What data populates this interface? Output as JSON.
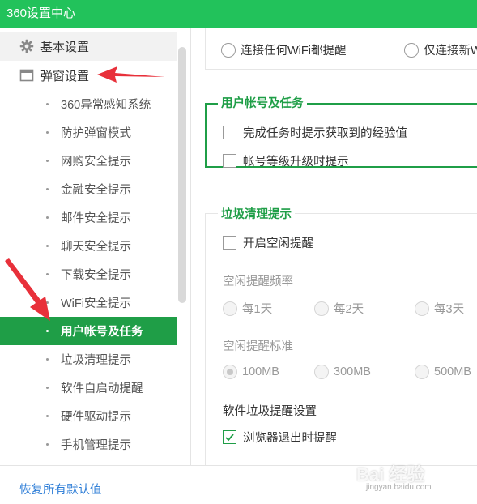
{
  "window": {
    "title": "360设置中心"
  },
  "sidebar": {
    "basic_label": "基本设置",
    "popup_label": "弹窗设置",
    "items": [
      {
        "label": "360异常感知系统"
      },
      {
        "label": "防护弹窗模式"
      },
      {
        "label": "网购安全提示"
      },
      {
        "label": "金融安全提示"
      },
      {
        "label": "邮件安全提示"
      },
      {
        "label": "聊天安全提示"
      },
      {
        "label": "下载安全提示"
      },
      {
        "label": "WiFi安全提示"
      },
      {
        "label": "用户帐号及任务"
      },
      {
        "label": "垃圾清理提示"
      },
      {
        "label": "软件自启动提醒"
      },
      {
        "label": "硬件驱动提示"
      },
      {
        "label": "手机管理提示"
      }
    ],
    "active_item": "用户帐号及任务"
  },
  "footer": {
    "restore_label": "恢复所有默认值"
  },
  "main": {
    "wifi": {
      "option_any": "连接任何WiFi都提醒",
      "option_new": "仅连接新Wi"
    },
    "account": {
      "title": "用户帐号及任务",
      "option_exp": "完成任务时提示获取到的经验值",
      "option_level": "帐号等级升级时提示"
    },
    "cleanup": {
      "title": "垃圾清理提示",
      "idle_toggle": "开启空闲提醒",
      "freq_label": "空闲提醒频率",
      "freq_options": [
        "每1天",
        "每2天",
        "每3天"
      ],
      "std_label": "空闲提醒标准",
      "std_options": [
        "100MB",
        "300MB",
        "500MB"
      ],
      "std_selected": "100MB",
      "software_label": "软件垃圾提醒设置",
      "browser_exit": "浏览器退出时提醒",
      "browser_exit_checked": true
    }
  },
  "watermark": {
    "text": "Bai 经验",
    "sub": "jingyan.baidu.com"
  },
  "colors": {
    "brand": "#22c25b",
    "active": "#1f9e47",
    "link": "#2a7bd6",
    "arrow": "#e8303a"
  }
}
